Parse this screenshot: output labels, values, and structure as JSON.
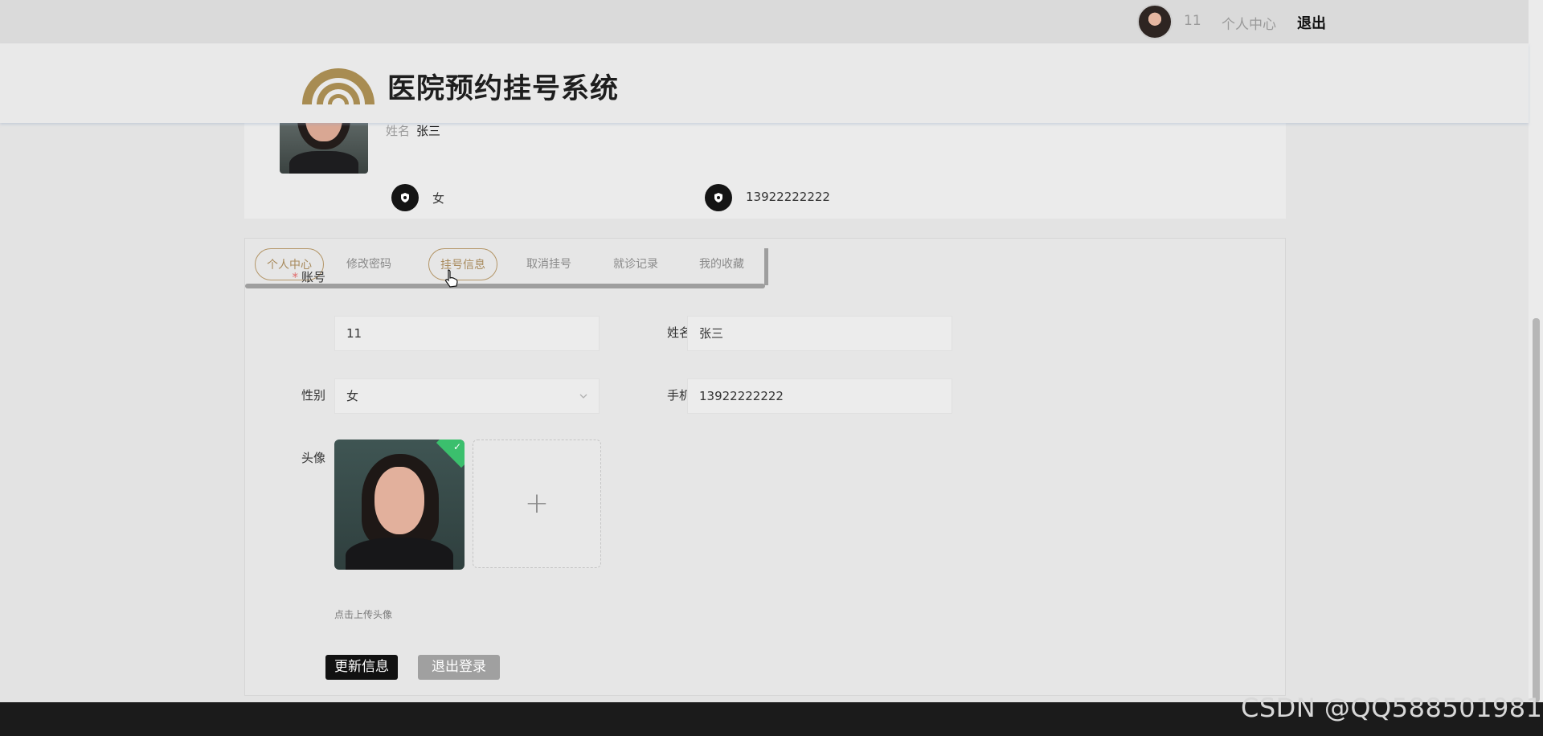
{
  "topbar": {
    "username": "11",
    "center_link": "个人中心",
    "logout_link": "退出"
  },
  "header": {
    "title": "医院预约挂号系统"
  },
  "profile": {
    "name_label": "姓名",
    "name": "张三",
    "sex": "女",
    "phone": "13922222222"
  },
  "tabs": [
    {
      "label": "个人中心",
      "active": true
    },
    {
      "label": "修改密码",
      "active": false
    },
    {
      "label": "挂号信息",
      "active": false,
      "hovered": true
    },
    {
      "label": "取消挂号",
      "active": false
    },
    {
      "label": "就诊记录",
      "active": false
    },
    {
      "label": "我的收藏",
      "active": false
    }
  ],
  "form": {
    "account_label": "账号",
    "account_required_mark": "*",
    "account_value": "11",
    "name_label": "姓名",
    "name_value": "张三",
    "sex_label": "性别",
    "sex_value": "女",
    "phone_label": "手机",
    "phone_value": "13922222222",
    "avatar_label": "头像",
    "upload_tip": "点击上传头像",
    "update_button": "更新信息",
    "logout_button": "退出登录"
  },
  "watermark": "CSDN @QQ588501981",
  "colors": {
    "accent_gold": "#b39566",
    "success_green": "#3bbf6d",
    "primary_button": "#111111"
  }
}
